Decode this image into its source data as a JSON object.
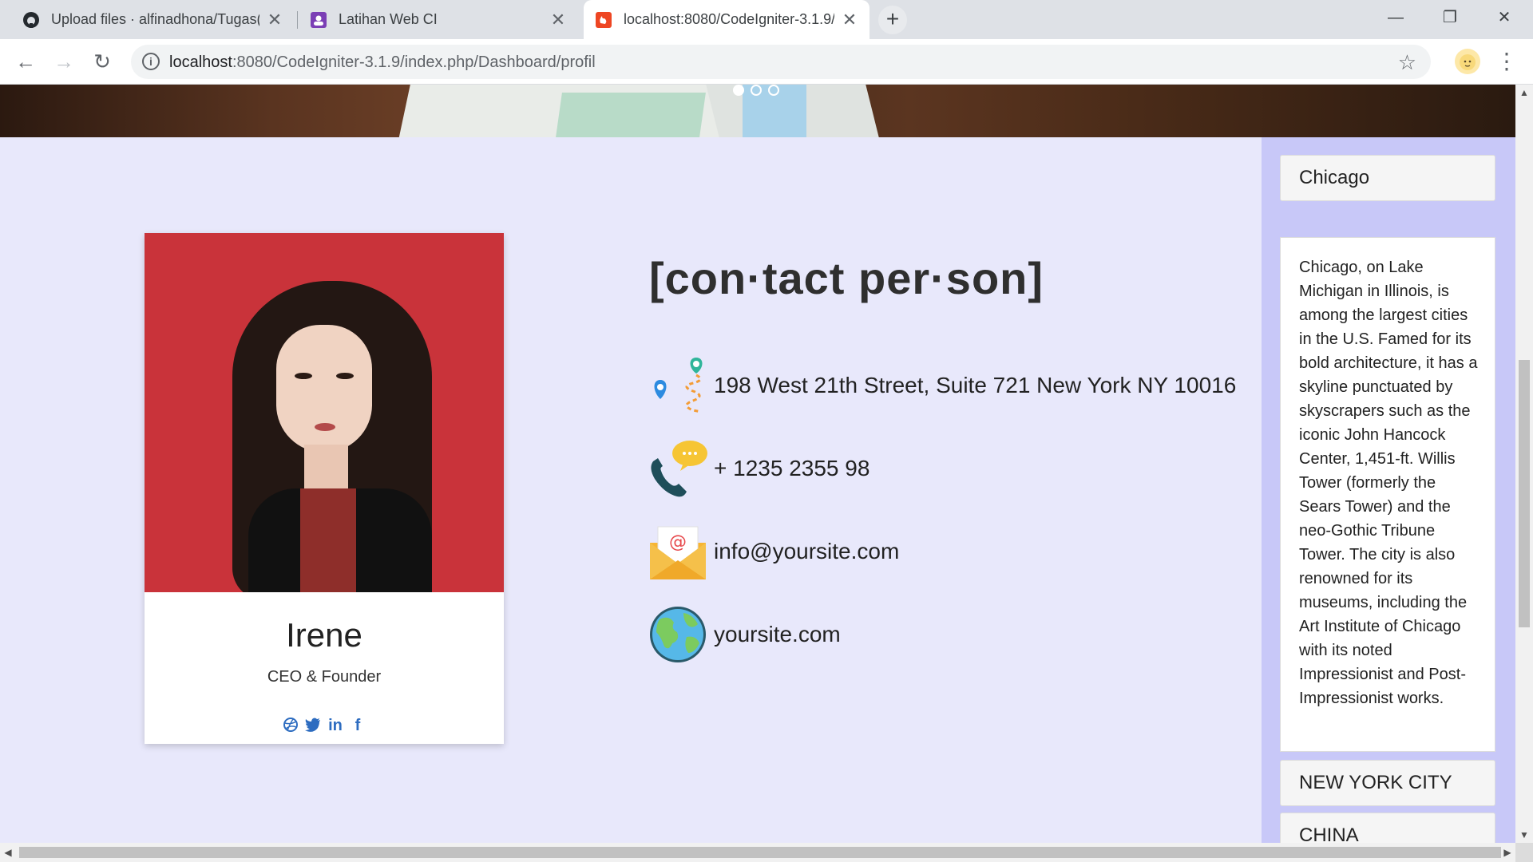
{
  "browser": {
    "tabs": [
      {
        "title": "Upload files · alfinadhona/Tugas(",
        "icon": "github-icon"
      },
      {
        "title": "Latihan Web CI",
        "icon": "classroom-icon"
      },
      {
        "title": "localhost:8080/CodeIgniter-3.1.9/",
        "icon": "codeigniter-icon"
      }
    ],
    "new_tab": "+",
    "url_host": "localhost",
    "url_rest": ":8080/CodeIgniter-3.1.9/index.php/Dashboard/profil",
    "controls": {
      "minimize": "—",
      "restore": "❐",
      "close": "✕"
    }
  },
  "profile_card": {
    "name": "Irene",
    "role": "CEO & Founder",
    "social_icons": [
      "dribbble-icon",
      "twitter-icon",
      "linkedin-icon",
      "facebook-icon"
    ]
  },
  "contact": {
    "title": "[con·tact per·son]",
    "items": [
      {
        "icon": "location-route-icon",
        "text": "198 West 21th Street, Suite 721 New York NY 10016"
      },
      {
        "icon": "phone-chat-icon",
        "text": "+ 1235 2355 98"
      },
      {
        "icon": "email-envelope-icon",
        "text": "info@yoursite.com"
      },
      {
        "icon": "globe-icon",
        "text": "yoursite.com"
      }
    ]
  },
  "sidebar": {
    "sections": [
      {
        "title": "Chicago",
        "expanded": true,
        "body": "Chicago, on Lake Michigan in Illinois, is among the largest cities in the U.S. Famed for its bold architecture, it has a skyline punctuated by skyscrapers such as the iconic John Hancock Center, 1,451-ft. Willis Tower (formerly the Sears Tower) and the neo-Gothic Tribune Tower. The city is also renowned for its museums, including the Art Institute of Chicago with its noted Impressionist and Post-Impressionist works."
      },
      {
        "title": "NEW YORK CITY",
        "expanded": false
      },
      {
        "title": "CHINA",
        "expanded": false
      }
    ]
  },
  "colors": {
    "page_bg": "#e8e8fb",
    "sidebar_bg": "#c8c8f8",
    "social_blue": "#2d6cc0",
    "photo_bg": "#c9333a"
  }
}
